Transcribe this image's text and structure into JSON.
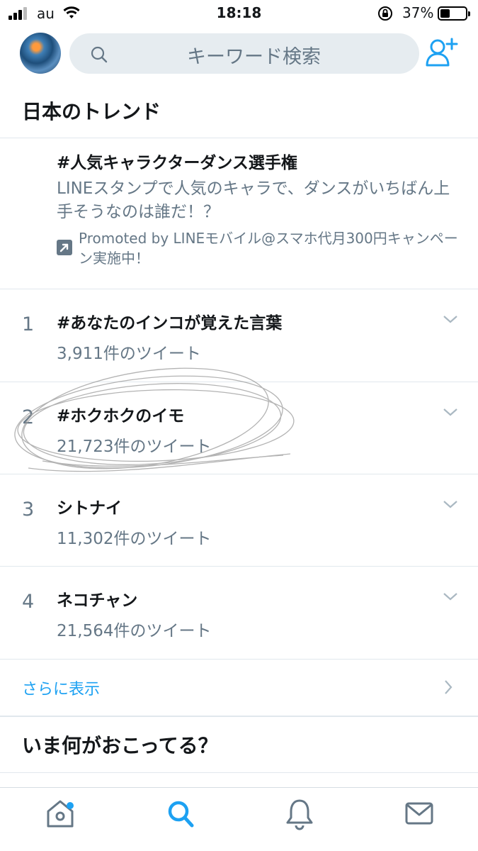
{
  "status_bar": {
    "carrier": "au",
    "time": "18:18",
    "battery": "37%",
    "battery_level": 0.37
  },
  "header": {
    "search_placeholder": "キーワード検索"
  },
  "trends_section": {
    "title": "日本のトレンド",
    "promoted": {
      "name": "#人気キャラクターダンス選手権",
      "description": "LINEスタンプで人気のキャラで、ダンスがいちばん上手そうなのは誰だ！？",
      "promoted_by": "Promoted by LINEモバイル@スマホ代月300円キャンペーン実施中！"
    },
    "items": [
      {
        "rank": "1",
        "name": "#あなたのインコが覚えた言葉",
        "count": "3,911件のツイート"
      },
      {
        "rank": "2",
        "name": "#ホクホクのイモ",
        "count": "21,723件のツイート"
      },
      {
        "rank": "3",
        "name": "シトナイ",
        "count": "11,302件のツイート"
      },
      {
        "rank": "4",
        "name": "ネコチャン",
        "count": "21,564件のツイート"
      }
    ],
    "show_more": "さらに表示"
  },
  "happening_section": {
    "title": "いま何がおこってる？"
  },
  "tabs": [
    {
      "icon": "home-icon",
      "active": false,
      "badge": true
    },
    {
      "icon": "search-icon",
      "active": true
    },
    {
      "icon": "bell-icon",
      "active": false
    },
    {
      "icon": "mail-icon",
      "active": false
    }
  ],
  "colors": {
    "accent": "#1da1f2",
    "secondary_text": "#657786",
    "primary_text": "#14171a",
    "search_bg": "#e6ecf0"
  }
}
